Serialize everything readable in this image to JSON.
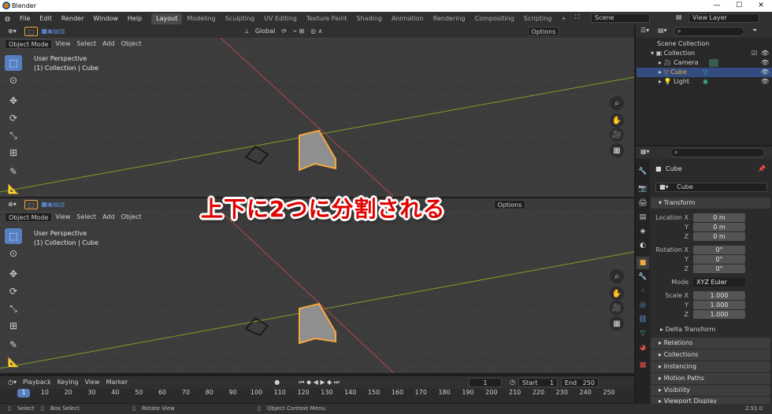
{
  "window": {
    "title": "Blender",
    "min": "—",
    "max": "☐",
    "close": "✕"
  },
  "menus": [
    "File",
    "Edit",
    "Render",
    "Window",
    "Help"
  ],
  "workspaces": [
    "Layout",
    "Modeling",
    "Sculpting",
    "UV Editing",
    "Texture Paint",
    "Shading",
    "Animation",
    "Rendering",
    "Compositing",
    "Scripting",
    "+"
  ],
  "scene": {
    "scene_name": "Scene",
    "view_layer": "View Layer"
  },
  "viewport": {
    "mode": "Object Mode",
    "menu": [
      "View",
      "Select",
      "Add",
      "Object"
    ],
    "orientation": "Global",
    "options": "Options",
    "overlay_line1": "User Perspective",
    "overlay_line2": "(1) Collection | Cube"
  },
  "annotation": "上下に2つに分割される",
  "outliner": {
    "search_placeholder": "",
    "items": [
      "Scene Collection",
      "Collection",
      "Camera",
      "Cube",
      "Light"
    ]
  },
  "properties": {
    "object_name": "Cube",
    "data_name": "Cube",
    "transform_header": "Transform",
    "location_label": "Location X",
    "rotation_label": "Rotation X",
    "scale_label": "Scale X",
    "axis_y": "Y",
    "axis_z": "Z",
    "location": [
      "0 m",
      "0 m",
      "0 m"
    ],
    "rotation": [
      "0°",
      "0°",
      "0°"
    ],
    "mode_label": "Mode",
    "mode_value": "XYZ Euler",
    "scale": [
      "1.000",
      "1.000",
      "1.000"
    ],
    "subpanels": [
      "Delta Transform",
      "Relations",
      "Collections",
      "Instancing",
      "Motion Paths",
      "Visibility",
      "Viewport Display"
    ]
  },
  "timeline": {
    "menu": [
      "Playback",
      "Keying",
      "View",
      "Marker"
    ],
    "current_frame": "1",
    "start_label": "Start",
    "start": "1",
    "end_label": "End",
    "end": "250",
    "ticks": [
      "1",
      "10",
      "20",
      "30",
      "40",
      "50",
      "60",
      "70",
      "80",
      "90",
      "100",
      "110",
      "120",
      "130",
      "140",
      "150",
      "160",
      "170",
      "180",
      "190",
      "200",
      "210",
      "220",
      "230",
      "240",
      "250"
    ]
  },
  "statusbar": {
    "select": "Select",
    "box_select": "Box Select",
    "rotate_view": "Rotate View",
    "context_menu": "Object Context Menu",
    "version": "2.91.0"
  },
  "colors": {
    "accent": "#5680c2",
    "selected_orange": "#f6a93f",
    "active_row": "#334d80",
    "annotation_red": "#e10000"
  }
}
